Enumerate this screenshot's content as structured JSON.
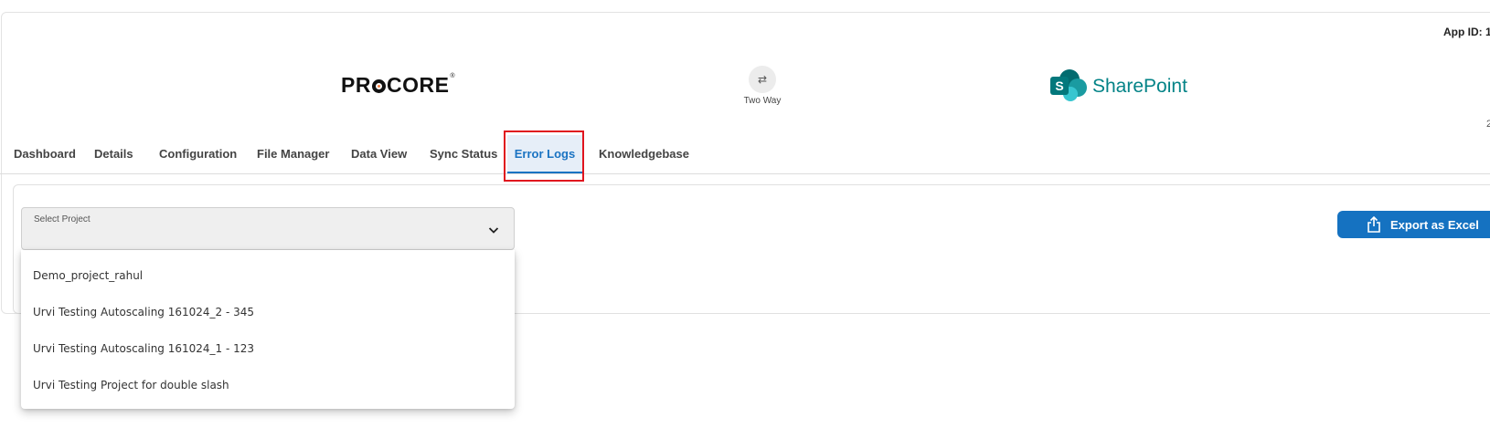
{
  "header": {
    "app_id_label": "App ID: 1",
    "edge_char": "2",
    "source_logo": {
      "name": "procore-logo",
      "text_before": "PR",
      "text_after": "CORE",
      "trademark": "®"
    },
    "sync": {
      "icon": "two-way-arrows-icon",
      "glyph": "⇄",
      "label": "Two Way"
    },
    "target_logo": {
      "name": "sharepoint-logo",
      "letter": "S",
      "text": "SharePoint"
    }
  },
  "tabs": [
    {
      "label": "Dashboard",
      "active": false
    },
    {
      "label": "Details",
      "active": false
    },
    {
      "label": "Configuration",
      "active": false
    },
    {
      "label": "File Manager",
      "active": false
    },
    {
      "label": "Data View",
      "active": false
    },
    {
      "label": "Sync Status",
      "active": false
    },
    {
      "label": "Error Logs",
      "active": true
    },
    {
      "label": "Knowledgebase",
      "active": false
    }
  ],
  "filters": {
    "project_select": {
      "label": "Select Project",
      "value": "",
      "icon": "chevron-down-icon",
      "options": [
        "Demo_project_rahul",
        "Urvi Testing Autoscaling 161024_2 - 345",
        "Urvi Testing Autoscaling 161024_1 - 123",
        "Urvi Testing Project for double slash"
      ]
    }
  },
  "actions": {
    "export_label": "Export as Excel",
    "export_icon": "share-upload-icon"
  },
  "colors": {
    "accent": "#1572c1",
    "highlight": "#e0141e",
    "sharepoint": "#038387",
    "procore_orange": "#f47e42"
  }
}
